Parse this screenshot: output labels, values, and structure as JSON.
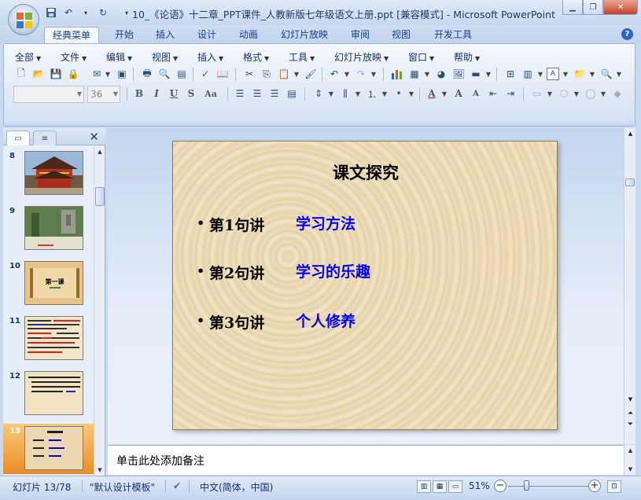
{
  "window": {
    "title": "10_《论语》十二章_PPT课件_人教新版七年级语文上册.ppt [兼容模式] - Microsoft PowerPoint",
    "controls": [
      "minimize",
      "restore",
      "close"
    ]
  },
  "quick_access": [
    "save-icon",
    "undo-icon",
    "redo-icon",
    "customize-icon"
  ],
  "tabs": [
    {
      "label": "经典菜单",
      "active": true
    },
    {
      "label": "开始"
    },
    {
      "label": "插入"
    },
    {
      "label": "设计"
    },
    {
      "label": "动画"
    },
    {
      "label": "幻灯片放映"
    },
    {
      "label": "审阅"
    },
    {
      "label": "视图"
    },
    {
      "label": "开发工具"
    }
  ],
  "menu": [
    "全部",
    "文件",
    "编辑",
    "视图",
    "插入",
    "格式",
    "工具",
    "幻灯片放映",
    "窗口",
    "帮助"
  ],
  "font": {
    "name": "",
    "size": "36"
  },
  "slides_panel": {
    "slides": [
      {
        "num": "8"
      },
      {
        "num": "9"
      },
      {
        "num": "10",
        "thumb_text": "第一课"
      },
      {
        "num": "11"
      },
      {
        "num": "12"
      },
      {
        "num": "13",
        "selected": true
      }
    ]
  },
  "slide": {
    "title": "课文探究",
    "bullets": [
      {
        "label": "第1句讲",
        "answer": "学习方法"
      },
      {
        "label": "第2句讲",
        "answer": "学习的乐趣"
      },
      {
        "label": "第3句讲",
        "answer": "个人修养"
      }
    ]
  },
  "notes": {
    "placeholder": "单击此处添加备注"
  },
  "status": {
    "slide_info": "幻灯片 13/78",
    "template": "\"默认设计模板\"",
    "language": "中文(简体，中国)",
    "zoom": "51%"
  },
  "colors": {
    "accent": "#15428b",
    "answer_text": "#0000ff",
    "selected_slide": "#e98d2a"
  }
}
